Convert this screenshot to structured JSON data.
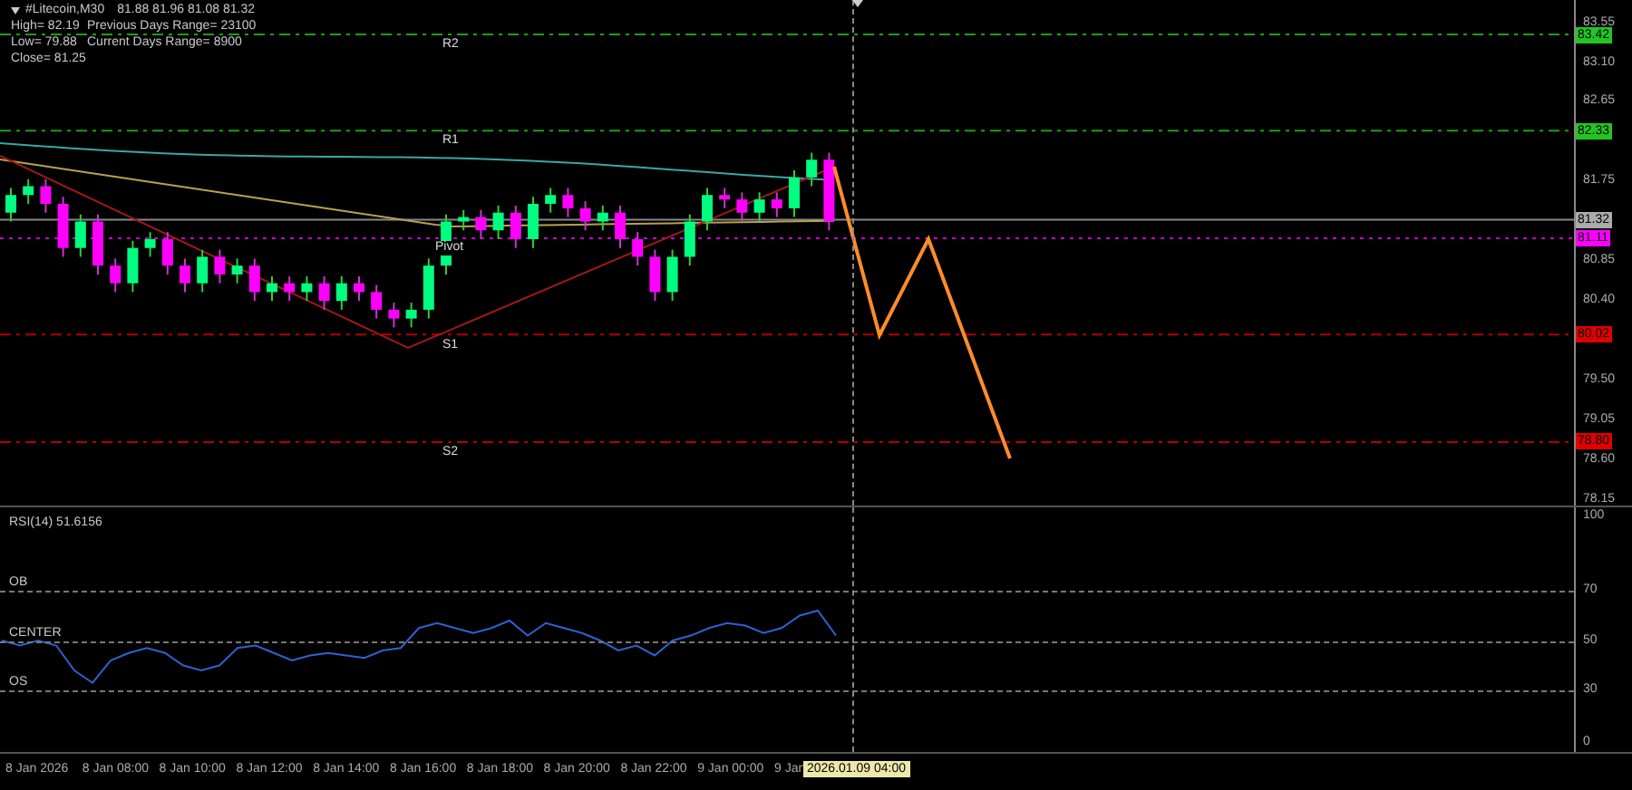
{
  "header": {
    "symbol": "#Litecoin,M30",
    "ohlc": "81.88 81.96 81.08 81.32",
    "high": "High= 82.19",
    "prev_range": "Previous Days Range= 23100",
    "low": "Low= 79.88",
    "curr_range": "Current Days Range= 8900",
    "close": "Close= 81.25"
  },
  "levels": [
    {
      "label": "R2",
      "price": "83.42",
      "kind": "resistance",
      "color": "#22c622"
    },
    {
      "label": "R1",
      "price": "82.33",
      "kind": "resistance",
      "color": "#22c622"
    },
    {
      "label": "Pivot",
      "price": "81.11",
      "kind": "pivot",
      "color": "#ff00ff"
    },
    {
      "label": "S1",
      "price": "80.02",
      "kind": "support",
      "color": "#e00000"
    },
    {
      "label": "S2",
      "price": "78.80",
      "kind": "support",
      "color": "#e00000"
    }
  ],
  "current_price": "81.32",
  "price_ticks": [
    "83.55",
    "83.10",
    "82.65",
    "81.75",
    "80.85",
    "80.40",
    "79.50",
    "79.05",
    "78.60",
    "78.15"
  ],
  "rsi": {
    "title": "RSI(14) 51.6156",
    "levels": [
      {
        "label": "OB",
        "value": "70"
      },
      {
        "label": "CENTER",
        "value": "50"
      },
      {
        "label": "OS",
        "value": "30"
      }
    ],
    "ticks": [
      "100",
      "0"
    ]
  },
  "time_axis": [
    "8 Jan 2026",
    "8 Jan 08:00",
    "8 Jan 10:00",
    "8 Jan 12:00",
    "8 Jan 14:00",
    "8 Jan 16:00",
    "8 Jan 18:00",
    "8 Jan 20:00",
    "8 Jan 22:00",
    "9 Jan 00:00",
    "9 Jan"
  ],
  "cursor_time": "2026.01.09 04:00"
}
